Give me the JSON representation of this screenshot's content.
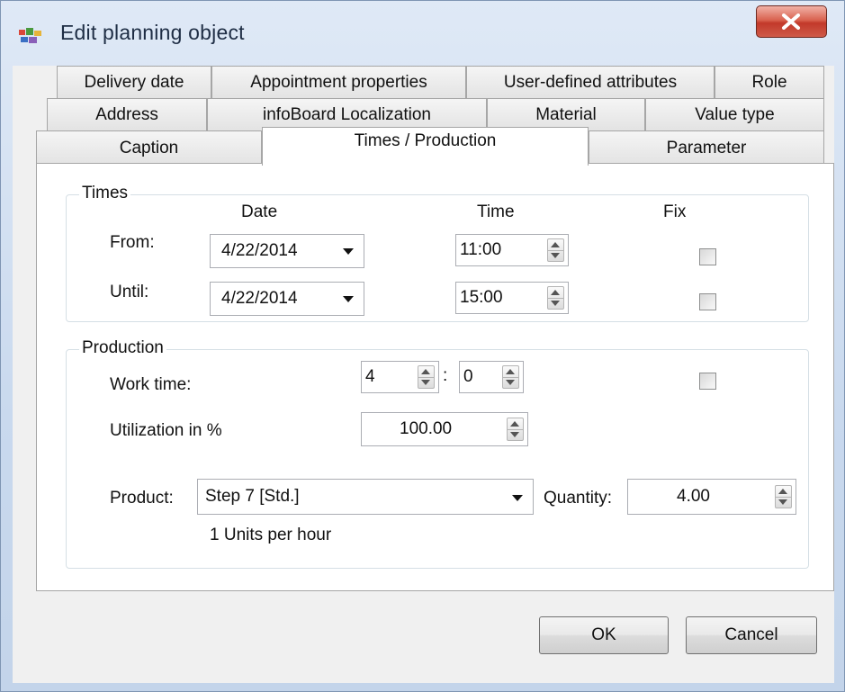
{
  "window": {
    "title": "Edit planning object"
  },
  "tabs": {
    "row1": [
      "Delivery date",
      "Appointment properties",
      "User-defined attributes",
      "Role"
    ],
    "row2": [
      "Address",
      "infoBoard Localization",
      "Material",
      "Value type"
    ],
    "row3": [
      "Caption",
      "Times / Production",
      "Parameter"
    ],
    "active": "Times / Production"
  },
  "times": {
    "legend": "Times",
    "col_date": "Date",
    "col_time": "Time",
    "col_fix": "Fix",
    "from_label": "From:",
    "until_label": "Until:",
    "from_date": "4/22/2014",
    "until_date": "4/22/2014",
    "from_time": "11:00",
    "until_time": "15:00",
    "from_fix": false,
    "until_fix": false
  },
  "production": {
    "legend": "Production",
    "work_time_label": "Work time:",
    "work_hours": "4",
    "separator": ":",
    "work_minutes": "0",
    "work_fix": false,
    "utilization_label": "Utilization in %",
    "utilization": "100.00",
    "product_label": "Product:",
    "product": "Step 7 [Std.]",
    "quantity_label": "Quantity:",
    "quantity": "4.00",
    "rate_text": "1 Units per hour"
  },
  "buttons": {
    "ok": "OK",
    "cancel": "Cancel"
  }
}
